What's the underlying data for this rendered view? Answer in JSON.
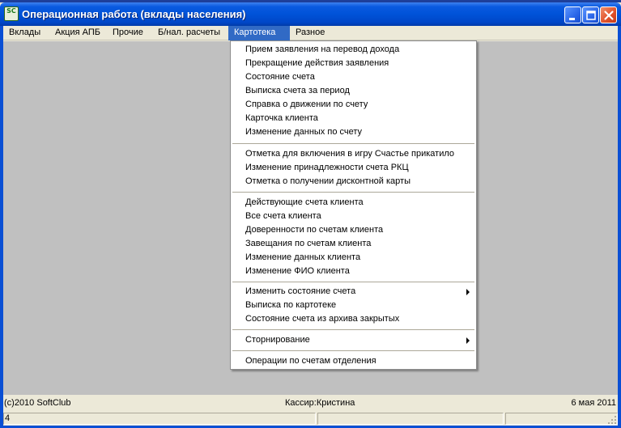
{
  "window": {
    "title": "Операционная работа (вклады населения)",
    "icon_text": "SC"
  },
  "menubar": {
    "items": [
      {
        "label": "Вклады"
      },
      {
        "label": "Акция АПБ"
      },
      {
        "label": "Прочие"
      },
      {
        "label": "Б/нал. расчеты"
      },
      {
        "label": "Картотека",
        "active": true
      },
      {
        "label": "Разное"
      }
    ]
  },
  "dropdown": {
    "groups": [
      [
        "Прием заявления на перевод дохода",
        "Прекращение действия заявления",
        "Состояние счета",
        "Выписка счета за период",
        "Справка о движении по счету",
        "Карточка клиента",
        "Изменение данных по счету"
      ],
      [
        "Отметка для включения в игру Счастье прикатило",
        "Изменение принадлежности счета РКЦ",
        "Отметка о получении дисконтной карты"
      ],
      [
        "Действующие счета клиента",
        "Все счета клиента",
        "Доверенности по счетам клиента",
        "Завещания по счетам клиента",
        "Изменение данных клиента",
        "Изменение ФИО клиента"
      ],
      [
        "Изменить состояние счета",
        "Выписка по картотеке",
        "Состояние счета из архива закрытых"
      ],
      [
        "Сторнирование"
      ],
      [
        "Операции по счетам отделения"
      ]
    ],
    "submenu_items": [
      "Изменить состояние счета",
      "Сторнирование"
    ]
  },
  "info_bar": {
    "copyright": "(c)2010 SoftClub",
    "cashier": "Кассир:Кристина",
    "date": "6 мая 2011"
  },
  "statusbar": {
    "panel1": "4",
    "panel2": "",
    "panel3": ""
  },
  "colors": {
    "titlebar": "#0052d8",
    "menu_highlight": "#316ac5",
    "workspace": "#c0c0c0",
    "chrome": "#ece9d8"
  }
}
